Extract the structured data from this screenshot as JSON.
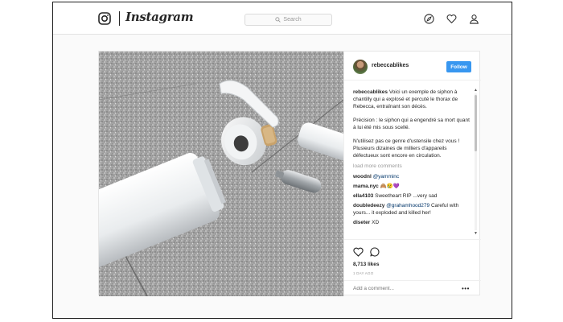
{
  "header": {
    "brand": "Instagram",
    "search_placeholder": "Search"
  },
  "post": {
    "username": "rebeccablikes",
    "follow_label": "Follow",
    "caption": {
      "username": "rebeccablikes",
      "paragraphs": [
        "Voici un exemple de siphon à chantilly qui a explosé et percuté le thorax de Rebecca, entraînant son décès.",
        "Précision : le siphon qui a engendré sa mort quant à lui été mis sous scellé.",
        "N'utilisez pas ce genre d'ustensile chez vous ! Plusieurs dizaines de milliers d'appareils défectueux sont encore en circulation."
      ]
    },
    "load_more": "load more comments",
    "comments": [
      {
        "user": "woodnl",
        "mention": "@yamminc",
        "text": ""
      },
      {
        "user": "mama.nyc",
        "mention": "",
        "text": "🙈😢💜"
      },
      {
        "user": "ella4103",
        "mention": "",
        "text": "Sweetheart RIP ...very sad"
      },
      {
        "user": "doubledeezy",
        "mention": "@grahamhood279",
        "text": "Careful with yours... it exploded and killed her!"
      },
      {
        "user": "diseter",
        "mention": "",
        "text": "XD"
      }
    ],
    "likes": "8,713 likes",
    "time": "1 DAY AGO",
    "add_comment_placeholder": "Add a comment...",
    "more": "•••"
  }
}
